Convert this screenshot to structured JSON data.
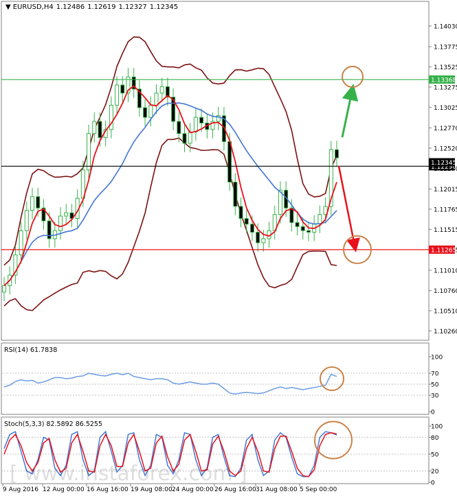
{
  "chart_data": {
    "type": "candlestick",
    "symbol": "EURUSD,H4",
    "ohlc": [
      "1.12486",
      "1.12619",
      "1.12327",
      "1.12345"
    ],
    "price_axis_ticks": [
      "1.14030",
      "1.13775",
      "1.13525",
      "1.13275",
      "1.13025",
      "1.12770",
      "1.12520",
      "1.12270",
      "1.12015",
      "1.11765",
      "1.11515",
      "1.11265",
      "1.11010",
      "1.10760",
      "1.10510",
      "1.10260"
    ],
    "ylim": [
      1.1017,
      1.1419
    ],
    "price_levels": [
      {
        "value": 1.13368,
        "label": "1.13368",
        "color": "#36b14a"
      },
      {
        "value": 1.12296,
        "label": "1.12296",
        "color": "#000000"
      },
      {
        "value": 1.11265,
        "label": "1.11265",
        "color": "#e8101a"
      }
    ],
    "current_price_label": "1.12345",
    "price_series_close": [
      1.1082,
      1.1095,
      1.112,
      1.115,
      1.1175,
      1.1192,
      1.1178,
      1.1162,
      1.114,
      1.115,
      1.1168,
      1.1172,
      1.1165,
      1.119,
      1.1225,
      1.127,
      1.1285,
      1.1265,
      1.1275,
      1.1305,
      1.133,
      1.132,
      1.134,
      1.1325,
      1.1302,
      1.129,
      1.1305,
      1.132,
      1.1328,
      1.1315,
      1.1285,
      1.127,
      1.1258,
      1.1272,
      1.129,
      1.1283,
      1.1275,
      1.1285,
      1.1292,
      1.126,
      1.121,
      1.118,
      1.1165,
      1.1158,
      1.1148,
      1.1135,
      1.114,
      1.115,
      1.117,
      1.12,
      1.1178,
      1.116,
      1.1155,
      1.115,
      1.1148,
      1.1158,
      1.117,
      1.118,
      1.125,
      1.124
    ],
    "rsi": {
      "label": "RSI(14) 61.7838",
      "ticks": [
        "100",
        "70",
        "50",
        "30",
        "0"
      ],
      "levels": [
        70,
        50,
        30
      ],
      "values": [
        45,
        48,
        55,
        58,
        56,
        57,
        52,
        54,
        58,
        62,
        62,
        60,
        61,
        64,
        65,
        70,
        68,
        66,
        65,
        68,
        70,
        67,
        70,
        64,
        62,
        60,
        58,
        60,
        60,
        58,
        52,
        50,
        52,
        54,
        52,
        50,
        50,
        52,
        50,
        42,
        34,
        32,
        34,
        35,
        34,
        33,
        34,
        38,
        42,
        45,
        42,
        44,
        42,
        40,
        42,
        44,
        46,
        48,
        68,
        64
      ]
    },
    "stochastic": {
      "label": "Stoch(5,3,3) 82.5892 86.5255",
      "ticks": [
        "100",
        "80",
        "50",
        "20",
        "0"
      ],
      "levels": [
        80,
        50,
        20
      ],
      "main": [
        60,
        85,
        90,
        55,
        20,
        15,
        40,
        80,
        75,
        25,
        12,
        30,
        85,
        90,
        40,
        12,
        20,
        80,
        90,
        55,
        18,
        30,
        85,
        88,
        40,
        12,
        30,
        85,
        80,
        30,
        15,
        40,
        88,
        85,
        40,
        12,
        25,
        80,
        85,
        45,
        12,
        10,
        25,
        75,
        85,
        40,
        12,
        20,
        75,
        88,
        80,
        45,
        15,
        10,
        10,
        30,
        80,
        90,
        88,
        84
      ],
      "signal": [
        50,
        75,
        85,
        65,
        35,
        20,
        35,
        70,
        78,
        40,
        18,
        25,
        70,
        85,
        55,
        20,
        18,
        65,
        85,
        65,
        28,
        28,
        70,
        85,
        55,
        20,
        25,
        70,
        82,
        45,
        20,
        32,
        75,
        85,
        55,
        20,
        22,
        68,
        82,
        55,
        20,
        12,
        20,
        60,
        80,
        55,
        20,
        18,
        60,
        82,
        82,
        55,
        25,
        12,
        10,
        22,
        65,
        85,
        88,
        86
      ]
    },
    "x_ticks": [
      "9 Aug 2016",
      "12 Aug 00:00",
      "16 Aug 16:00",
      "19 Aug 08:00",
      "24 Aug 00:00",
      "26 Aug 16:00",
      "31 Aug 08:00",
      "5 Sep 00:00"
    ],
    "watermark": "[ www.instaforex.com ]",
    "colors": {
      "candle": "#36b14a",
      "ma_fast": "#e8101a",
      "ma_slow": "#4478d8",
      "bollinger": "#7a1010",
      "rsi": "#6b9be3",
      "stoch_main": "#4478d8",
      "stoch_signal": "#e8101a",
      "circle": "#c8824a",
      "up_arrow": "#36b14a",
      "down_arrow": "#e8101a"
    }
  }
}
